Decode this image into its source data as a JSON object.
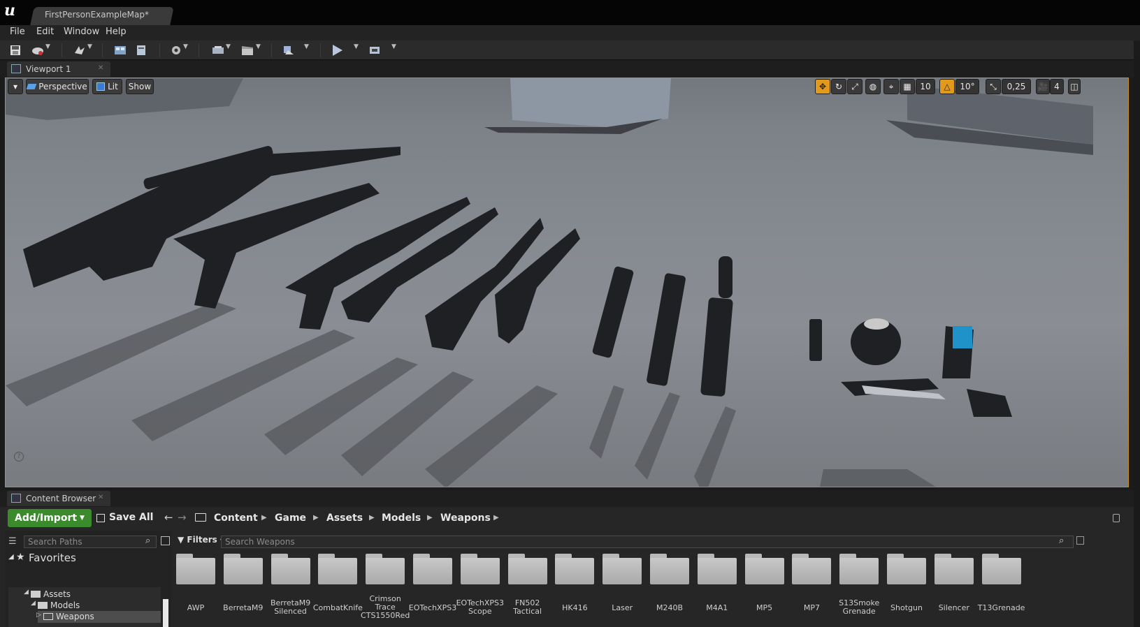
{
  "window": {
    "doc_tab": "FirstPersonExampleMap*"
  },
  "menu": [
    "File",
    "Edit",
    "Window",
    "Help"
  ],
  "toolbar_icons": [
    "save-icon",
    "source-control-icon",
    "modes-icon",
    "content-icon",
    "blueprints-icon",
    "cinematics-icon",
    "build-icon",
    "compile-icon",
    "play-icon",
    "launch-icon"
  ],
  "viewport": {
    "tab_label": "Viewport 1",
    "perspective_label": "Perspective",
    "lit_label": "Lit",
    "show_label": "Show",
    "grid_snap": "10",
    "rotation_snap": "10°",
    "scale_snap": "0,25",
    "camera_speed": "4"
  },
  "content_browser": {
    "tab_label": "Content Browser",
    "add_import": "Add/Import",
    "save_all": "Save All",
    "breadcrumbs": [
      "Content",
      "Game",
      "Assets",
      "Models",
      "Weapons"
    ],
    "search_paths_placeholder": "Search Paths",
    "filters_label": "Filters",
    "search_assets_placeholder": "Search Weapons",
    "favorites_label": "Favorites",
    "tree": {
      "assets": "Assets",
      "models": "Models",
      "weapons": "Weapons"
    },
    "folders": [
      "AWP",
      "BerretaM9",
      "BerretaM9\nSilenced",
      "CombatKnife",
      "Crimson\nTrace\nCTS1550Red",
      "EOTechXPS3",
      "EOTechXPS3\nScope",
      "FN502\nTactical",
      "HK416",
      "Laser",
      "M240B",
      "M4A1",
      "MP5",
      "MP7",
      "S13Smoke\nGrenade",
      "Shotgun",
      "Silencer",
      "T13Grenade"
    ]
  },
  "colors": {
    "accent": "#e29a1d",
    "add_import": "#3b8a2c",
    "viewport_border": "#c98a18"
  }
}
